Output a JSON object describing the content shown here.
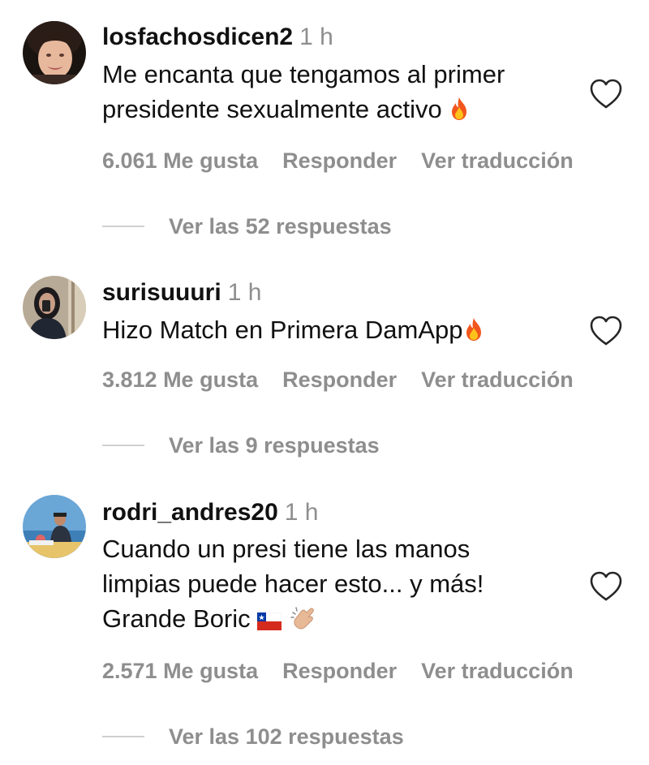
{
  "comments": [
    {
      "username": "losfachosdicen2",
      "time": "1 h",
      "text": "Me encanta que tengamos al primer presidente sexualmente activo",
      "emoji": "fire-icon",
      "likes": "6.061 Me gusta",
      "reply": "Responder",
      "translate": "Ver traducción",
      "replies": "Ver las 52 respuestas"
    },
    {
      "username": "surisuuuri",
      "time": "1 h",
      "text": "Hizo Match en Primera DamApp",
      "emoji": "fire-icon",
      "likes": "3.812 Me gusta",
      "reply": "Responder",
      "translate": "Ver traducción",
      "replies": "Ver las 9 respuestas"
    },
    {
      "username": "rodri_andres20",
      "time": "1 h",
      "text_line1": "Cuando un presi tiene las manos",
      "text_line2": "limpias puede hacer esto... y más!",
      "text_line3": "Grande Boric",
      "emoji": "chile-flag-icon clapping-hands-icon",
      "likes": "2.571 Me gusta",
      "reply": "Responder",
      "translate": "Ver traducción",
      "replies": "Ver las 102 respuestas"
    }
  ],
  "colors": {
    "text": "#111111",
    "secondary": "#8e8e8e",
    "divider": "#d0d0d0"
  }
}
